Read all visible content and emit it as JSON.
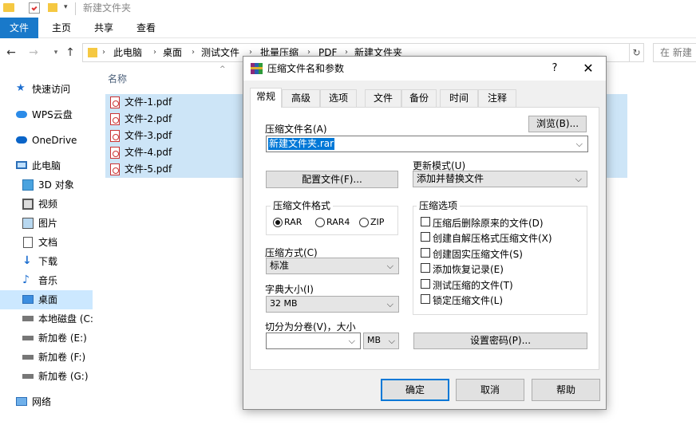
{
  "window": {
    "title": "新建文件夹"
  },
  "ribbon": {
    "tabs": [
      "文件",
      "主页",
      "共享",
      "查看"
    ]
  },
  "address": {
    "crumbs": [
      "此电脑",
      "桌面",
      "测试文件",
      "批量压缩",
      "PDF",
      "新建文件夹"
    ],
    "search_placeholder": "在 新建"
  },
  "nav": {
    "quick_access": "快速访问",
    "wps": "WPS云盘",
    "onedrive": "OneDrive",
    "this_pc": "此电脑",
    "items": [
      "3D 对象",
      "视频",
      "图片",
      "文档",
      "下载",
      "音乐",
      "桌面",
      "本地磁盘 (C:",
      "新加卷 (E:)",
      "新加卷 (F:)",
      "新加卷 (G:)"
    ],
    "network": "网络"
  },
  "files": {
    "column_name": "名称",
    "rows": [
      "文件-1.pdf",
      "文件-2.pdf",
      "文件-3.pdf",
      "文件-4.pdf",
      "文件-5.pdf"
    ]
  },
  "dialog": {
    "title": "压缩文件名和参数",
    "help": "?",
    "tabs": [
      "常规",
      "高级",
      "选项",
      "文件",
      "备份",
      "时间",
      "注释"
    ],
    "archive_name_label": "压缩文件名(A)",
    "browse_button": "浏览(B)...",
    "archive_name_value": "新建文件夹.rar",
    "update_mode_label": "更新模式(U)",
    "update_mode_value": "添加并替换文件",
    "profiles_button": "配置文件(F)...",
    "format_group": "压缩文件格式",
    "formats": [
      "RAR",
      "RAR4",
      "ZIP"
    ],
    "selected_format": "RAR",
    "method_label": "压缩方式(C)",
    "method_value": "标准",
    "dict_label": "字典大小(I)",
    "dict_value": "32 MB",
    "split_label": "切分为分卷(V)，大小",
    "split_value": "",
    "split_unit": "MB",
    "options_group": "压缩选项",
    "options": [
      "压缩后删除原来的文件(D)",
      "创建自解压格式压缩文件(X)",
      "创建固实压缩文件(S)",
      "添加恢复记录(E)",
      "测试压缩的文件(T)",
      "锁定压缩文件(L)"
    ],
    "password_button": "设置密码(P)...",
    "ok": "确定",
    "cancel": "取消",
    "helpbtn": "帮助"
  },
  "colors": {
    "accent": "#0078d7",
    "selection": "#cde5f7",
    "file_tab": "#1979ca"
  }
}
